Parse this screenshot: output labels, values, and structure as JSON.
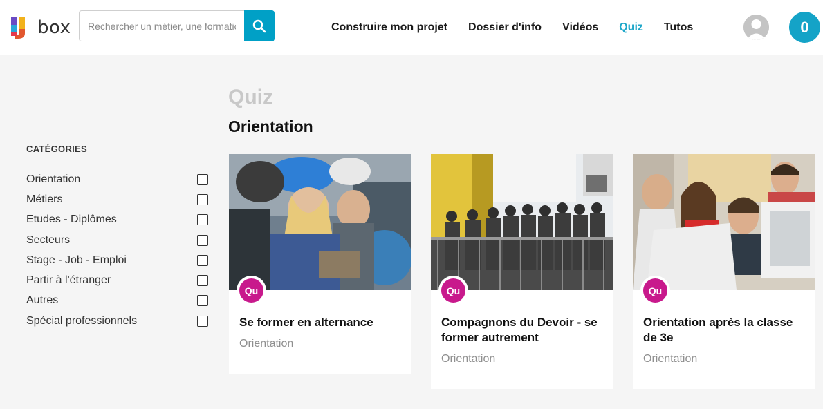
{
  "header": {
    "logo_text": "box",
    "search": {
      "placeholder": "Rechercher un métier, une formation",
      "icon": "search-icon"
    },
    "nav": [
      {
        "label": "Construire mon projet",
        "active": false
      },
      {
        "label": "Dossier d'info",
        "active": false
      },
      {
        "label": "Vidéos",
        "active": false
      },
      {
        "label": "Quiz",
        "active": true
      },
      {
        "label": "Tutos",
        "active": false
      }
    ],
    "cart_count": "0"
  },
  "sidebar": {
    "title": "CATÉGORIES",
    "items": [
      {
        "label": "Orientation"
      },
      {
        "label": "Métiers"
      },
      {
        "label": "Etudes - Diplômes"
      },
      {
        "label": "Secteurs"
      },
      {
        "label": "Stage - Job - Emploi"
      },
      {
        "label": "Partir à l'étranger"
      },
      {
        "label": "Autres"
      },
      {
        "label": "Spécial professionnels"
      }
    ]
  },
  "main": {
    "title": "Quiz",
    "subtitle": "Orientation",
    "cards": [
      {
        "badge": "Qu",
        "title": "Se former en alternance",
        "category": "Orientation"
      },
      {
        "badge": "Qu",
        "title": "Compagnons du Devoir - se former autrement",
        "category": "Orientation"
      },
      {
        "badge": "Qu",
        "title": "Orientation après la classe de 3e",
        "category": "Orientation"
      }
    ]
  },
  "colors": {
    "accent": "#00a0c6",
    "badge": "#c8198c",
    "active_nav": "#1fa7c9"
  }
}
